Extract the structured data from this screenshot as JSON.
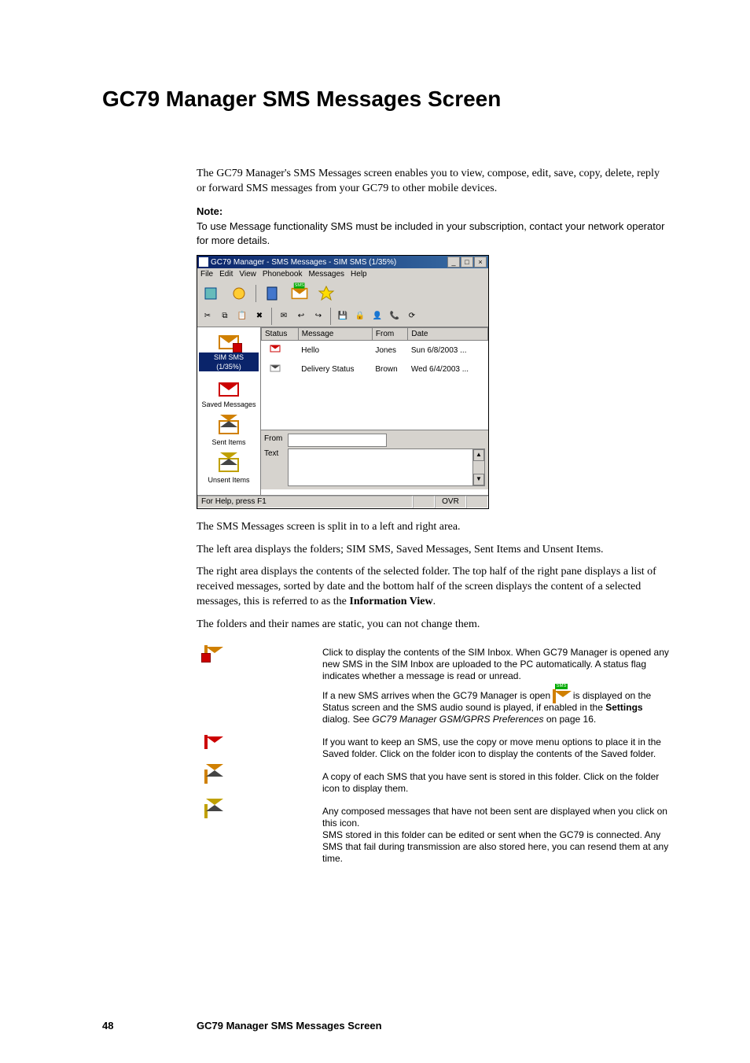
{
  "page": {
    "number": "48",
    "footer_title": "GC79 Manager SMS Messages Screen"
  },
  "heading": "GC79 Manager SMS Messages Screen",
  "intro": "The GC79 Manager's SMS Messages screen enables you to view, compose, edit, save, copy, delete, reply or forward SMS messages from your GC79 to other mobile devices.",
  "note": {
    "label": "Note:",
    "body": "To use Message functionality SMS must be included in your subscription, contact your network operator for more details."
  },
  "after_paras": {
    "p1": "The SMS Messages screen is split in to a left and right area.",
    "p2": "The left area displays the folders; SIM SMS, Saved Messages, Sent Items and Unsent Items.",
    "p3_a": "The right area displays the contents of the selected folder. The top half of the right pane displays a list of received messages, sorted by date and the bottom half of the screen displays the content of a selected messages, this is referred to as the ",
    "p3_b": "Information View",
    "p3_c": ".",
    "p4": "The folders and their names are static, you can not change them."
  },
  "app": {
    "title": "GC79 Manager - SMS Messages - SIM SMS (1/35%)",
    "wincontrols": {
      "min": "_",
      "max": "□",
      "close": "×"
    },
    "menu": [
      "File",
      "Edit",
      "View",
      "Phonebook",
      "Messages",
      "Help"
    ],
    "folders": [
      {
        "label": "SIM SMS (1/35%)",
        "selected": true
      },
      {
        "label": "Saved Messages",
        "selected": false
      },
      {
        "label": "Sent Items",
        "selected": false
      },
      {
        "label": "Unsent Items",
        "selected": false
      }
    ],
    "list": {
      "headers": [
        "Status",
        "Message",
        "From",
        "Date"
      ],
      "rows": [
        {
          "status": "unread",
          "message": "Hello",
          "from": "Jones",
          "date": "Sun 6/8/2003 ..."
        },
        {
          "status": "read",
          "message": "Delivery Status",
          "from": "Brown",
          "date": "Wed 6/4/2003 ..."
        }
      ]
    },
    "info": {
      "from_label": "From",
      "from_value": "",
      "text_label": "Text",
      "text_value": ""
    },
    "statusbar": {
      "help": "For Help, press F1",
      "ovr": "OVR"
    }
  },
  "folder_desc": [
    {
      "icon": "sim-inbox-icon",
      "text_a": "Click to display the contents of the SIM Inbox. When GC79 Manager is opened any new SMS in the SIM Inbox are uploaded to the PC automatically. A status flag indicates whether a message is read or unread.",
      "text_b_1": "If a new SMS arrives when the GC79 Manager is open ",
      "text_b_inline_icon": "sms-new-icon",
      "text_b_2": " is displayed on the Status screen and the SMS audio sound is played, if enabled in the ",
      "text_b_bold": "Settings",
      "text_b_3": " dialog. See ",
      "text_b_italic": "GC79 Manager GSM/GPRS Preferences",
      "text_b_4": " on page 16."
    },
    {
      "icon": "saved-folder-icon",
      "text_a": "If you want to keep an SMS, use the copy or move menu options to place it in the Saved folder. Click on the folder icon to display the contents of the Saved folder."
    },
    {
      "icon": "sent-folder-icon",
      "text_a": "A copy of each SMS that you have sent is stored in this folder. Click on the folder icon to display them."
    },
    {
      "icon": "unsent-folder-icon",
      "text_a": "Any composed messages that have not been sent are displayed when you click on this icon.\nSMS stored in this folder can be edited or sent when the GC79 is connected. Any SMS that fail during transmission are also stored here, you can resend them at any time."
    }
  ]
}
